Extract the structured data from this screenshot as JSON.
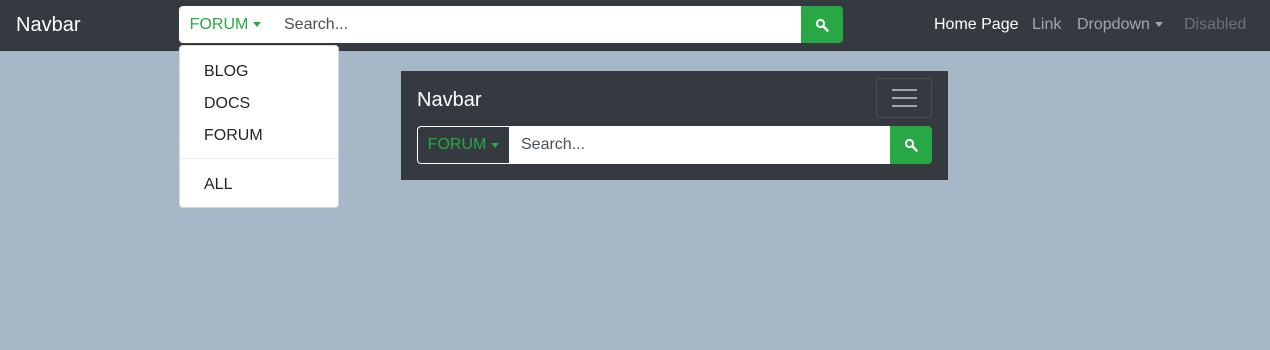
{
  "top_nav": {
    "brand": "Navbar",
    "search": {
      "category": "FORUM",
      "placeholder": "Search..."
    },
    "links": {
      "home": "Home Page",
      "link": "Link",
      "dropdown": "Dropdown",
      "disabled": "Disabled"
    }
  },
  "category_menu": {
    "items": [
      "BLOG",
      "DOCS",
      "FORUM"
    ],
    "all": "ALL"
  },
  "collapsed_nav": {
    "brand": "Navbar",
    "search": {
      "category": "FORUM",
      "placeholder": "Search..."
    }
  },
  "icons": {
    "search": "search-icon",
    "toggler": "hamburger-icon",
    "caret": "caret-down-icon"
  },
  "colors": {
    "navbar_bg": "#343a40",
    "page_bg": "#a6b7c8",
    "accent_green": "#28a745"
  }
}
